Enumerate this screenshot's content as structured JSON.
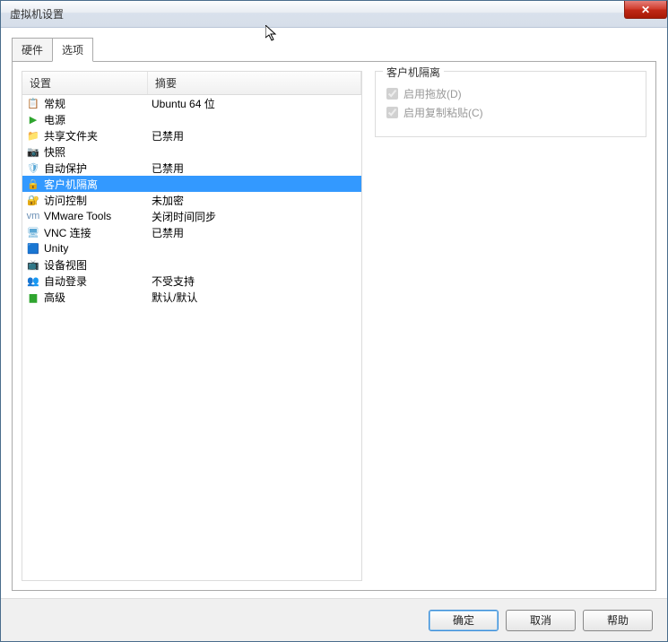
{
  "window": {
    "title": "虚拟机设置"
  },
  "tabs": {
    "hardware": "硬件",
    "options": "选项",
    "active": "options"
  },
  "list": {
    "header_setting": "设置",
    "header_summary": "摘要",
    "rows": [
      {
        "icon": "📋",
        "name": "row-general",
        "setting": "常规",
        "summary": "Ubuntu 64 位"
      },
      {
        "icon": "▶",
        "icon_color": "#2fa52f",
        "name": "row-power",
        "setting": "电源",
        "summary": ""
      },
      {
        "icon": "📁",
        "icon_color": "#d9a300",
        "name": "row-shared-folders",
        "setting": "共享文件夹",
        "summary": "已禁用"
      },
      {
        "icon": "📷",
        "icon_color": "#5ca9d6",
        "name": "row-snapshots",
        "setting": "快照",
        "summary": ""
      },
      {
        "icon": "🛡",
        "icon_color": "#5ca9d6",
        "name": "row-autoprotect",
        "setting": "自动保护",
        "summary": "已禁用"
      },
      {
        "icon": "🔒",
        "icon_color": "#ffffff",
        "name": "row-guest-isolation",
        "setting": "客户机隔离",
        "summary": "",
        "selected": true
      },
      {
        "icon": "🔐",
        "icon_color": "#5ca9d6",
        "name": "row-access-control",
        "setting": "访问控制",
        "summary": "未加密"
      },
      {
        "icon": "vm",
        "icon_color": "#6a8fb5",
        "name": "row-vmware-tools",
        "setting": "VMware Tools",
        "summary": "关闭时间同步"
      },
      {
        "icon": "🖥",
        "icon_color": "#5ca9d6",
        "name": "row-vnc",
        "setting": "VNC 连接",
        "summary": "已禁用"
      },
      {
        "icon": "🟦",
        "icon_color": "#3a7fc2",
        "name": "row-unity",
        "setting": "Unity",
        "summary": ""
      },
      {
        "icon": "📺",
        "icon_color": "#d9a300",
        "name": "row-device-view",
        "setting": "设备视图",
        "summary": ""
      },
      {
        "icon": "👥",
        "icon_color": "#d9a300",
        "name": "row-autologon",
        "setting": "自动登录",
        "summary": "不受支持"
      },
      {
        "icon": "▆",
        "icon_color": "#2fa52f",
        "name": "row-advanced",
        "setting": "高级",
        "summary": "默认/默认"
      }
    ]
  },
  "panel": {
    "title": "客户机隔离",
    "enable_drag": "启用拖放(D)",
    "enable_copy": "启用复制粘贴(C)"
  },
  "buttons": {
    "ok": "确定",
    "cancel": "取消",
    "help": "帮助"
  }
}
